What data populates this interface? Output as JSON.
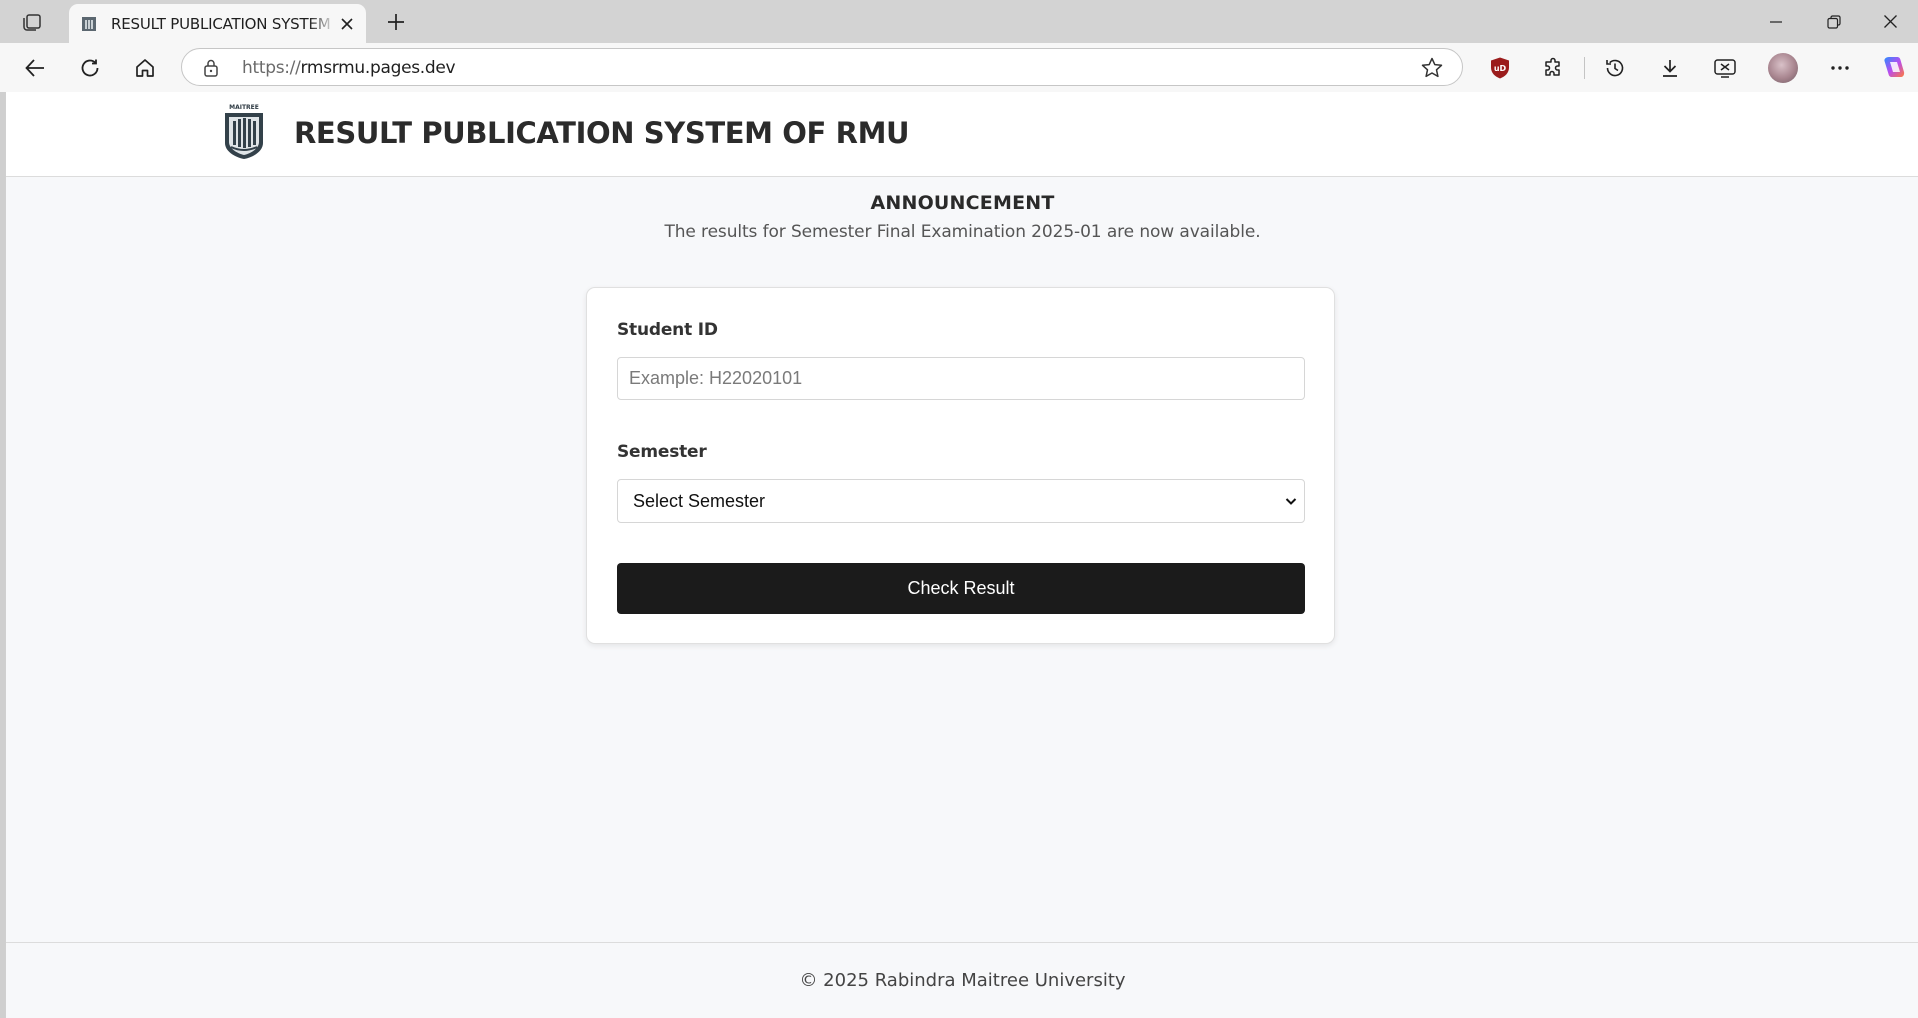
{
  "browser": {
    "tab": {
      "title": "RESULT PUBLICATION SYSTEM - R"
    },
    "address": {
      "scheme": "https://",
      "host": "rmsrmu.pages.dev"
    },
    "extension_badge_color": "#9b1c1c",
    "icons": [
      "tab-actions-icon",
      "close-icon",
      "plus-icon",
      "minimize-icon",
      "restore-icon",
      "close-window-icon",
      "back-icon",
      "refresh-icon",
      "home-icon",
      "lock-icon",
      "star-icon",
      "ublock-icon",
      "extensions-icon",
      "history-icon",
      "download-icon",
      "screenshot-icon",
      "more-icon",
      "copilot-icon"
    ]
  },
  "site": {
    "title": "RESULT PUBLICATION SYSTEM OF RMU",
    "logo_text": "MAITREE"
  },
  "announcement": {
    "title": "ANNOUNCEMENT",
    "text": "The results for Semester Final Examination 2025-01 are now available."
  },
  "form": {
    "student_id": {
      "label": "Student ID",
      "placeholder": "Example: H22020101",
      "value": ""
    },
    "semester": {
      "label": "Semester",
      "selected": "Select Semester"
    },
    "submit_label": "Check Result"
  },
  "footer": {
    "text": "© 2025 Rabindra Maitree University"
  }
}
